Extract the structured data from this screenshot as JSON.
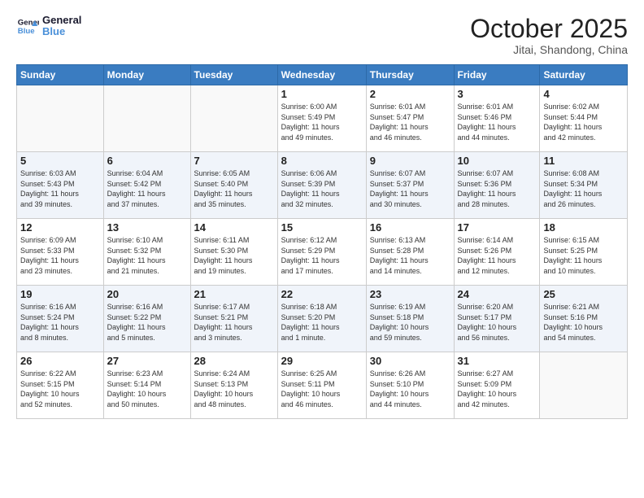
{
  "logo": {
    "line1": "General",
    "line2": "Blue"
  },
  "title": "October 2025",
  "location": "Jitai, Shandong, China",
  "weekdays": [
    "Sunday",
    "Monday",
    "Tuesday",
    "Wednesday",
    "Thursday",
    "Friday",
    "Saturday"
  ],
  "weeks": [
    [
      {
        "day": "",
        "info": ""
      },
      {
        "day": "",
        "info": ""
      },
      {
        "day": "",
        "info": ""
      },
      {
        "day": "1",
        "info": "Sunrise: 6:00 AM\nSunset: 5:49 PM\nDaylight: 11 hours\nand 49 minutes."
      },
      {
        "day": "2",
        "info": "Sunrise: 6:01 AM\nSunset: 5:47 PM\nDaylight: 11 hours\nand 46 minutes."
      },
      {
        "day": "3",
        "info": "Sunrise: 6:01 AM\nSunset: 5:46 PM\nDaylight: 11 hours\nand 44 minutes."
      },
      {
        "day": "4",
        "info": "Sunrise: 6:02 AM\nSunset: 5:44 PM\nDaylight: 11 hours\nand 42 minutes."
      }
    ],
    [
      {
        "day": "5",
        "info": "Sunrise: 6:03 AM\nSunset: 5:43 PM\nDaylight: 11 hours\nand 39 minutes."
      },
      {
        "day": "6",
        "info": "Sunrise: 6:04 AM\nSunset: 5:42 PM\nDaylight: 11 hours\nand 37 minutes."
      },
      {
        "day": "7",
        "info": "Sunrise: 6:05 AM\nSunset: 5:40 PM\nDaylight: 11 hours\nand 35 minutes."
      },
      {
        "day": "8",
        "info": "Sunrise: 6:06 AM\nSunset: 5:39 PM\nDaylight: 11 hours\nand 32 minutes."
      },
      {
        "day": "9",
        "info": "Sunrise: 6:07 AM\nSunset: 5:37 PM\nDaylight: 11 hours\nand 30 minutes."
      },
      {
        "day": "10",
        "info": "Sunrise: 6:07 AM\nSunset: 5:36 PM\nDaylight: 11 hours\nand 28 minutes."
      },
      {
        "day": "11",
        "info": "Sunrise: 6:08 AM\nSunset: 5:34 PM\nDaylight: 11 hours\nand 26 minutes."
      }
    ],
    [
      {
        "day": "12",
        "info": "Sunrise: 6:09 AM\nSunset: 5:33 PM\nDaylight: 11 hours\nand 23 minutes."
      },
      {
        "day": "13",
        "info": "Sunrise: 6:10 AM\nSunset: 5:32 PM\nDaylight: 11 hours\nand 21 minutes."
      },
      {
        "day": "14",
        "info": "Sunrise: 6:11 AM\nSunset: 5:30 PM\nDaylight: 11 hours\nand 19 minutes."
      },
      {
        "day": "15",
        "info": "Sunrise: 6:12 AM\nSunset: 5:29 PM\nDaylight: 11 hours\nand 17 minutes."
      },
      {
        "day": "16",
        "info": "Sunrise: 6:13 AM\nSunset: 5:28 PM\nDaylight: 11 hours\nand 14 minutes."
      },
      {
        "day": "17",
        "info": "Sunrise: 6:14 AM\nSunset: 5:26 PM\nDaylight: 11 hours\nand 12 minutes."
      },
      {
        "day": "18",
        "info": "Sunrise: 6:15 AM\nSunset: 5:25 PM\nDaylight: 11 hours\nand 10 minutes."
      }
    ],
    [
      {
        "day": "19",
        "info": "Sunrise: 6:16 AM\nSunset: 5:24 PM\nDaylight: 11 hours\nand 8 minutes."
      },
      {
        "day": "20",
        "info": "Sunrise: 6:16 AM\nSunset: 5:22 PM\nDaylight: 11 hours\nand 5 minutes."
      },
      {
        "day": "21",
        "info": "Sunrise: 6:17 AM\nSunset: 5:21 PM\nDaylight: 11 hours\nand 3 minutes."
      },
      {
        "day": "22",
        "info": "Sunrise: 6:18 AM\nSunset: 5:20 PM\nDaylight: 11 hours\nand 1 minute."
      },
      {
        "day": "23",
        "info": "Sunrise: 6:19 AM\nSunset: 5:18 PM\nDaylight: 10 hours\nand 59 minutes."
      },
      {
        "day": "24",
        "info": "Sunrise: 6:20 AM\nSunset: 5:17 PM\nDaylight: 10 hours\nand 56 minutes."
      },
      {
        "day": "25",
        "info": "Sunrise: 6:21 AM\nSunset: 5:16 PM\nDaylight: 10 hours\nand 54 minutes."
      }
    ],
    [
      {
        "day": "26",
        "info": "Sunrise: 6:22 AM\nSunset: 5:15 PM\nDaylight: 10 hours\nand 52 minutes."
      },
      {
        "day": "27",
        "info": "Sunrise: 6:23 AM\nSunset: 5:14 PM\nDaylight: 10 hours\nand 50 minutes."
      },
      {
        "day": "28",
        "info": "Sunrise: 6:24 AM\nSunset: 5:13 PM\nDaylight: 10 hours\nand 48 minutes."
      },
      {
        "day": "29",
        "info": "Sunrise: 6:25 AM\nSunset: 5:11 PM\nDaylight: 10 hours\nand 46 minutes."
      },
      {
        "day": "30",
        "info": "Sunrise: 6:26 AM\nSunset: 5:10 PM\nDaylight: 10 hours\nand 44 minutes."
      },
      {
        "day": "31",
        "info": "Sunrise: 6:27 AM\nSunset: 5:09 PM\nDaylight: 10 hours\nand 42 minutes."
      },
      {
        "day": "",
        "info": ""
      }
    ]
  ]
}
